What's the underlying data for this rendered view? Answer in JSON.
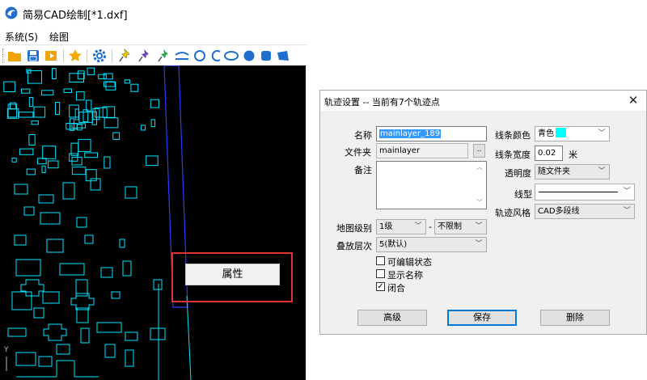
{
  "app": {
    "title": "简易CAD绘制[*1.dxf]"
  },
  "menu": [
    "系统(S)",
    "绘图"
  ],
  "toolbar": {
    "icons": [
      "open-folder-icon",
      "save-icon",
      "export-icon",
      "favorite-star-icon",
      "settings-gear-icon",
      "pin-yellow-icon",
      "pin-purple-icon",
      "pin-green-icon",
      "arc-tool-icon",
      "circle-tool-icon",
      "arc-open-tool-icon",
      "ellipse-tool-icon",
      "filled-circle-tool-icon",
      "rounded-rect-tool-icon",
      "polygon-tool-icon"
    ],
    "colors": {
      "folder": "#f0a30a",
      "blue": "#1f6fd1",
      "star": "#f3a900",
      "yellow_pin": "#e8d000",
      "purple_pin": "#6a3fb5",
      "green_pin": "#2aa84a"
    }
  },
  "canvas": {
    "background": "#000000",
    "stroke_color": "#00e5ff",
    "track_color": "#2a3cff",
    "axis_label": "Y"
  },
  "context_menu": {
    "item": "属性"
  },
  "highlight_color": "#e0322e",
  "dialog": {
    "title": "轨迹设置 -- 当前有7个轨迹点",
    "close": "✕",
    "name_label": "名称",
    "name_value": "mainlayer_189",
    "folder_label": "文件夹",
    "folder_value": "mainlayer",
    "browse_label": "..",
    "note_label": "备注",
    "note_value": "",
    "map_level_label": "地图级别",
    "map_level_from": "1级",
    "map_level_dash": "-",
    "map_level_to": "不限制",
    "stack_label": "叠放层次",
    "stack_value": "5(默认)",
    "editable_label": "可编辑状态",
    "editable_checked": false,
    "show_name_label": "显示名称",
    "show_name_checked": false,
    "closed_label": "闭合",
    "closed_checked": true,
    "line_color_label": "线条颜色",
    "line_color_value": "青色",
    "line_color_hex": "#00ffff",
    "line_width_label": "线条宽度",
    "line_width_value": "0.02",
    "line_width_unit": "米",
    "opacity_label": "透明度",
    "opacity_value": "随文件夹",
    "line_type_label": "线型",
    "track_style_label": "轨迹风格",
    "track_style_value": "CAD多段线",
    "buttons": {
      "advanced": "高级",
      "save": "保存",
      "delete": "删除"
    }
  }
}
